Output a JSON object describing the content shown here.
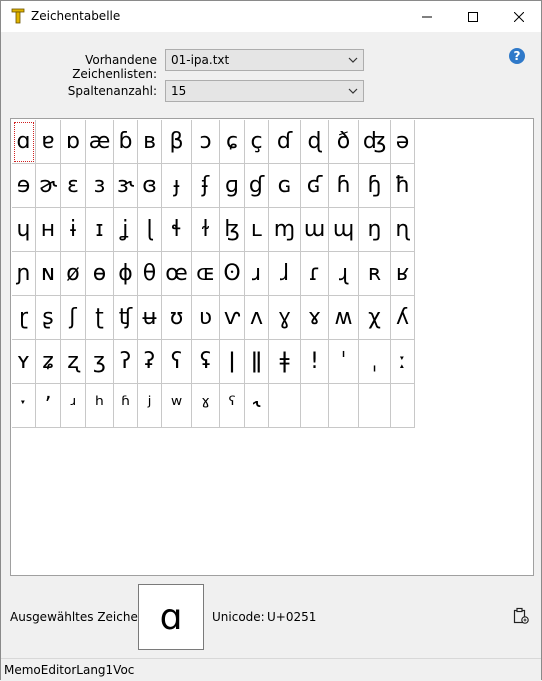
{
  "window": {
    "title": "Zeichentabelle",
    "minimize_glyph": "—",
    "maximize_glyph": "☐",
    "close_glyph": "✕"
  },
  "form": {
    "lists_label": "Vorhandene Zeichenlisten:",
    "lists_value": "01-ipa.txt",
    "columns_label": "Spaltenanzahl:",
    "columns_value": "15"
  },
  "help": {
    "icon": "help-icon",
    "glyph": "?"
  },
  "grid": {
    "cells": [
      "ɑ",
      "ɐ",
      "ɒ",
      "æ",
      "ɓ",
      "ʙ",
      "β",
      "ɔ",
      "ɕ",
      "ç",
      "ɗ",
      "ɖ",
      "ð",
      "ʤ",
      "ə",
      "ɘ",
      "ɚ",
      "ɛ",
      "ɜ",
      "ɝ",
      "ɞ",
      "ɟ",
      "ʄ",
      "ɡ",
      "ɠ",
      "ɢ",
      "ʛ",
      "ɦ",
      "ɧ",
      "ħ",
      "ɥ",
      "ʜ",
      "ɨ",
      "ɪ",
      "ʝ",
      "ɭ",
      "ɬ",
      "ɫ",
      "ɮ",
      "ʟ",
      "ɱ",
      "ɯ",
      "ɰ",
      "ŋ",
      "ɳ",
      "ɲ",
      "ɴ",
      "ø",
      "ɵ",
      "ɸ",
      "θ",
      "œ",
      "ɶ",
      "ʘ",
      "ɹ",
      "ɺ",
      "ɾ",
      "ɻ",
      "ʀ",
      "ʁ",
      "ɽ",
      "ʂ",
      "ʃ",
      "ʈ",
      "ʧ",
      "ʉ",
      "ʊ",
      "ʋ",
      "ⱱ",
      "ʌ",
      "ɣ",
      "ɤ",
      "ʍ",
      "χ",
      "ʎ",
      "ʏ",
      "ʑ",
      "ʐ",
      "ʒ",
      "ʔ",
      "ʡ",
      "ʕ",
      "ʢ",
      "ǀ",
      "ǁ",
      "ǂ",
      "ǃ",
      "ˈ",
      "ˌ",
      "ː",
      "ˑ",
      "ʼ",
      "ʴ",
      "ʰ",
      "ʱ",
      "ʲ",
      "ʷ",
      "ˠ",
      "ˤ",
      "˞",
      "",
      "",
      "",
      "",
      ""
    ],
    "empty_rows": 0
  },
  "selection": {
    "label": "Ausgewähltes Zeichen:",
    "char": "ɑ",
    "unicode_label": "Unicode:",
    "unicode_value": "U+0251",
    "copy_icon": "clipboard-icon"
  },
  "status": {
    "text": "MemoEditorLang1Voc"
  }
}
